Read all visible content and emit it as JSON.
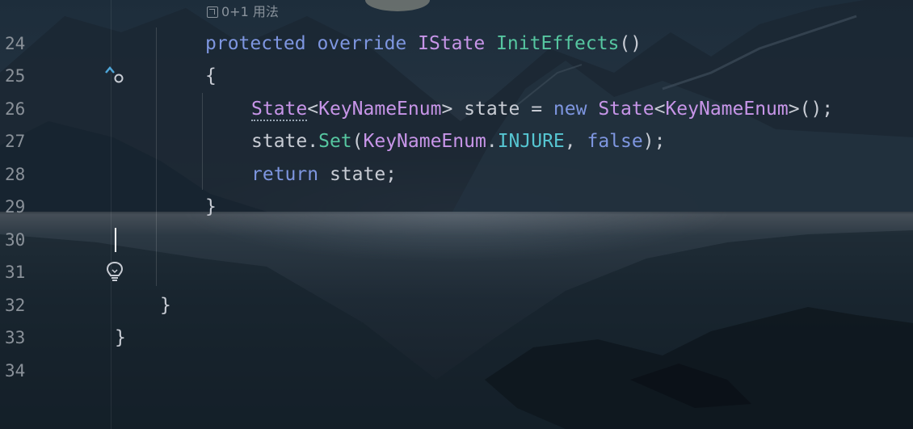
{
  "editor": {
    "usage_hint": "0+1 用法",
    "lines": [
      {
        "number": "24",
        "code": {
          "kw1": "protected",
          "kw2": "override",
          "type": "IState",
          "method": "InitEffects",
          "paren": "()"
        }
      },
      {
        "number": "25",
        "text": "{"
      },
      {
        "number": "26",
        "code": {
          "type1": "State",
          "lt": "<",
          "type2": "KeyNameEnum",
          "gt": ">",
          "var": " state = ",
          "kw": "new",
          "type3": "State",
          "lt2": "<",
          "type4": "KeyNameEnum",
          "end": ">();"
        }
      },
      {
        "number": "27",
        "code": {
          "obj": "state.",
          "method": "Set",
          "open": "(",
          "type": "KeyNameEnum",
          "dot": ".",
          "enum": "INJURE",
          "comma": ", ",
          "kw": "false",
          "end": ");"
        }
      },
      {
        "number": "28",
        "code": {
          "kw": "return",
          "rest": " state;"
        }
      },
      {
        "number": "29",
        "text": "}"
      },
      {
        "number": "30",
        "text": ""
      },
      {
        "number": "31",
        "text": ""
      },
      {
        "number": "32",
        "text": "}"
      },
      {
        "number": "33",
        "text": "}"
      },
      {
        "number": "34",
        "text": ""
      }
    ],
    "gutter_icons": {
      "line24": "overrides-method-icon",
      "line30": "lightbulb-intention-icon"
    }
  }
}
